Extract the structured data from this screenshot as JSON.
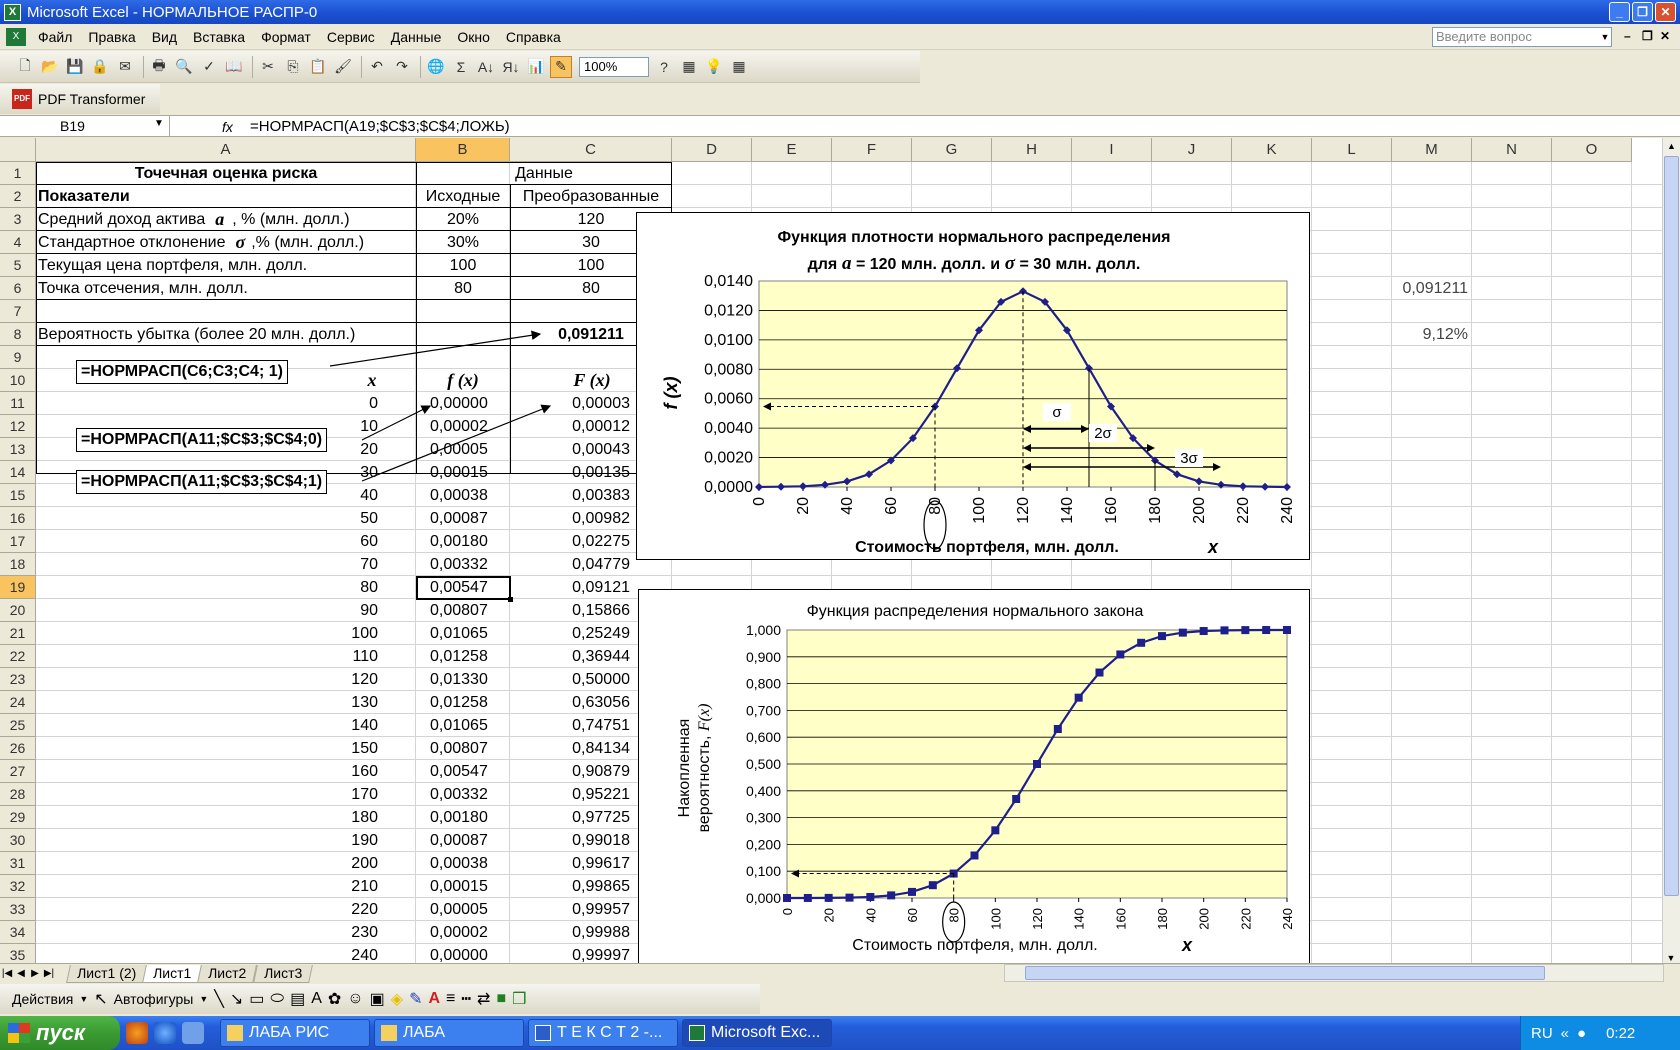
{
  "window": {
    "title": "Microsoft Excel - НОРМАЛЬНОЕ РАСПР-0"
  },
  "menu": {
    "items": [
      "Файл",
      "Правка",
      "Вид",
      "Вставка",
      "Формат",
      "Сервис",
      "Данные",
      "Окно",
      "Справка"
    ],
    "ask_placeholder": "Введите вопрос"
  },
  "toolbar": {
    "zoom": "100%",
    "pdf_label": "PDF Transformer"
  },
  "formula_bar": {
    "name_box": "B19",
    "fx": "fx",
    "formula": "=НОРМРАСП(A19;$C$3;$C$4;ЛОЖЬ)"
  },
  "columns": [
    "A",
    "B",
    "C",
    "D",
    "E",
    "F",
    "G",
    "H",
    "I",
    "J",
    "K",
    "L",
    "M",
    "N",
    "O"
  ],
  "rows": [
    "1",
    "2",
    "3",
    "4",
    "5",
    "6",
    "7",
    "8",
    "9",
    "10",
    "11",
    "12",
    "13",
    "14",
    "15",
    "16",
    "17",
    "18",
    "19",
    "20",
    "21",
    "22",
    "23",
    "24",
    "25",
    "26",
    "27",
    "28",
    "29",
    "30",
    "31",
    "32",
    "33",
    "34",
    "35"
  ],
  "sheet": {
    "a1": "Точечная оценка риска",
    "bc1": "Данные",
    "a2": "Показатели",
    "b2": "Исходные",
    "c2": "Преобразованные",
    "a3": "Средний доход актива",
    "a3_sym": "a",
    "a3_tail": ", % (млн. долл.)",
    "a4": "Стандартное отклонение",
    "a4_sym": "σ",
    "a4_tail": ",% (млн. долл.)",
    "a5": "Текущая цена портфеля, млн. долл.",
    "a6": "Точка отсечения, млн. долл.",
    "a8": "Вероятность убытка (более 20 млн. долл.)",
    "b3": "20%",
    "c3": "120",
    "b4": "30%",
    "c4": "30",
    "b5": "100",
    "c5": "100",
    "b6": "80",
    "c6": "80",
    "c8": "0,091211",
    "m6": "0,091211",
    "m8": "9,12%",
    "hdr_x": "x",
    "hdr_fx": "f (x)",
    "hdr_Fx": "F (x)"
  },
  "table": [
    {
      "x": "0",
      "f": "0,00000",
      "F": "0,00003"
    },
    {
      "x": "10",
      "f": "0,00002",
      "F": "0,00012"
    },
    {
      "x": "20",
      "f": "0,00005",
      "F": "0,00043"
    },
    {
      "x": "30",
      "f": "0,00015",
      "F": "0,00135"
    },
    {
      "x": "40",
      "f": "0,00038",
      "F": "0,00383"
    },
    {
      "x": "50",
      "f": "0,00087",
      "F": "0,00982"
    },
    {
      "x": "60",
      "f": "0,00180",
      "F": "0,02275"
    },
    {
      "x": "70",
      "f": "0,00332",
      "F": "0,04779"
    },
    {
      "x": "80",
      "f": "0,00547",
      "F": "0,09121"
    },
    {
      "x": "90",
      "f": "0,00807",
      "F": "0,15866"
    },
    {
      "x": "100",
      "f": "0,01065",
      "F": "0,25249"
    },
    {
      "x": "110",
      "f": "0,01258",
      "F": "0,36944"
    },
    {
      "x": "120",
      "f": "0,01330",
      "F": "0,50000"
    },
    {
      "x": "130",
      "f": "0,01258",
      "F": "0,63056"
    },
    {
      "x": "140",
      "f": "0,01065",
      "F": "0,74751"
    },
    {
      "x": "150",
      "f": "0,00807",
      "F": "0,84134"
    },
    {
      "x": "160",
      "f": "0,00547",
      "F": "0,90879"
    },
    {
      "x": "170",
      "f": "0,00332",
      "F": "0,95221"
    },
    {
      "x": "180",
      "f": "0,00180",
      "F": "0,97725"
    },
    {
      "x": "190",
      "f": "0,00087",
      "F": "0,99018"
    },
    {
      "x": "200",
      "f": "0,00038",
      "F": "0,99617"
    },
    {
      "x": "210",
      "f": "0,00015",
      "F": "0,99865"
    },
    {
      "x": "220",
      "f": "0,00005",
      "F": "0,99957"
    },
    {
      "x": "230",
      "f": "0,00002",
      "F": "0,99988"
    },
    {
      "x": "240",
      "f": "0,00000",
      "F": "0,99997"
    }
  ],
  "callouts": {
    "c1": "=НОРМРАСП(C6;C3;C4; 1)",
    "c2": "=НОРМРАСП(A11;$C$3;$C$4;0)",
    "c3": "=НОРМРАСП(A11;$C$3;$C$4;1)"
  },
  "chart_data": [
    {
      "type": "line",
      "title": "Функция плотности нормального распределения",
      "subtitle_parts": [
        "для",
        "a",
        "= 120 млн. долл. и",
        "σ",
        "= 30 млн. долл."
      ],
      "xlabel": "Стоимость портфеля, млн. долл.",
      "xlabel_var": "x",
      "ylabel": "f (x)",
      "x": [
        0,
        10,
        20,
        30,
        40,
        50,
        60,
        70,
        80,
        90,
        100,
        110,
        120,
        130,
        140,
        150,
        160,
        170,
        180,
        190,
        200,
        210,
        220,
        230,
        240
      ],
      "y": [
        0,
        2e-05,
        5e-05,
        0.00015,
        0.00038,
        0.00087,
        0.0018,
        0.00332,
        0.00547,
        0.00807,
        0.01065,
        0.01258,
        0.0133,
        0.01258,
        0.01065,
        0.00807,
        0.00547,
        0.00332,
        0.0018,
        0.00087,
        0.00038,
        0.00015,
        5e-05,
        2e-05,
        0
      ],
      "xticks": [
        "0",
        "20",
        "40",
        "60",
        "80",
        "100",
        "120",
        "140",
        "160",
        "180",
        "200",
        "220",
        "240"
      ],
      "yticks": [
        "0,0000",
        "0,0020",
        "0,0040",
        "0,0060",
        "0,0080",
        "0,0100",
        "0,0120",
        "0,0140"
      ],
      "ylim": [
        0,
        0.014
      ],
      "xlim": [
        0,
        240
      ],
      "annotations": [
        "σ",
        "2σ",
        "3σ"
      ],
      "color": "#1F1F8C",
      "plot_bg": "#FFFFC8"
    },
    {
      "type": "line",
      "title": "Функция распределения нормального закона",
      "xlabel": "Стоимость портфеля, млн. долл.",
      "xlabel_var": "x",
      "ylabel": "Накопленная вероятность,",
      "ylabel_var": "F(x)",
      "x": [
        0,
        10,
        20,
        30,
        40,
        50,
        60,
        70,
        80,
        90,
        100,
        110,
        120,
        130,
        140,
        150,
        160,
        170,
        180,
        190,
        200,
        210,
        220,
        230,
        240
      ],
      "y": [
        3e-05,
        0.00012,
        0.00043,
        0.00135,
        0.00383,
        0.00982,
        0.02275,
        0.04779,
        0.09121,
        0.15866,
        0.25249,
        0.36944,
        0.5,
        0.63056,
        0.74751,
        0.84134,
        0.90879,
        0.95221,
        0.97725,
        0.99018,
        0.99617,
        0.99865,
        0.99957,
        0.99988,
        0.99997
      ],
      "xticks": [
        "0",
        "20",
        "40",
        "60",
        "80",
        "100",
        "120",
        "140",
        "160",
        "180",
        "200",
        "220",
        "240"
      ],
      "yticks": [
        "0,000",
        "0,100",
        "0,200",
        "0,300",
        "0,400",
        "0,500",
        "0,600",
        "0,700",
        "0,800",
        "0,900",
        "1,000"
      ],
      "ylim": [
        0,
        1
      ],
      "xlim": [
        0,
        240
      ],
      "color": "#1F1F8C",
      "plot_bg": "#FFFFC8"
    }
  ],
  "sheet_tabs": [
    "Лист1 (2)",
    "Лист1",
    "Лист2",
    "Лист3"
  ],
  "drawbar": {
    "actions": "Действия",
    "autoshapes": "Автофигуры"
  },
  "taskbar": {
    "start": "пуск",
    "tasks": [
      "ЛАБА РИС",
      "ЛАБА",
      "Т Е К С Т 2 -...",
      "Microsoft Exc..."
    ],
    "lang": "RU",
    "clock": "0:22"
  }
}
